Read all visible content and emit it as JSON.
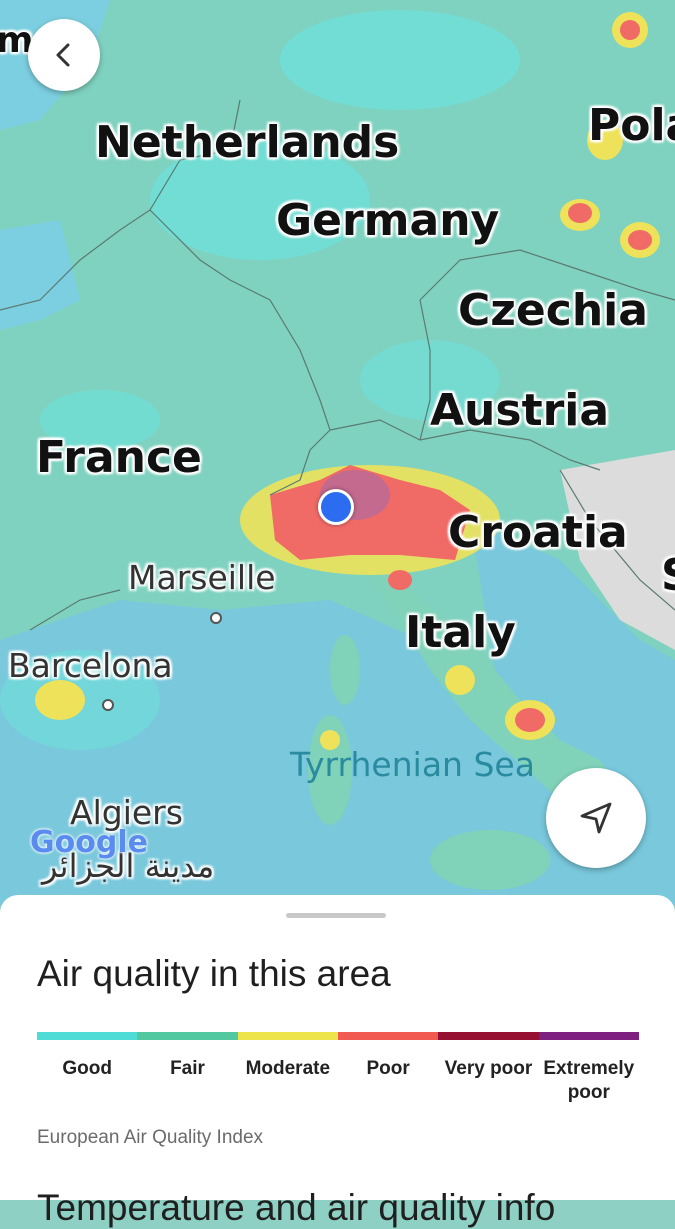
{
  "map": {
    "countries": [
      "Netherlands",
      "Germany",
      "Czechia",
      "Austria",
      "France",
      "Croatia",
      "Italy",
      "Pola"
    ],
    "cities": [
      "Marseille",
      "Barcelona",
      "Algiers"
    ],
    "algiers_arabic": "مدينة الجزائر",
    "sea": "Tyrrhenian Sea",
    "top_left_partial": "m",
    "right_partial": "S",
    "watermark": "Google",
    "back_icon": "chevron-left-icon",
    "recenter_icon": "navigation-arrow-icon"
  },
  "sheet": {
    "title": "Air quality in this area",
    "legend": [
      {
        "label": "Good",
        "color": "#4fdcd6"
      },
      {
        "label": "Fair",
        "color": "#52c8a0"
      },
      {
        "label": "Moderate",
        "color": "#ece44a"
      },
      {
        "label": "Poor",
        "color": "#f05a50"
      },
      {
        "label": "Very poor",
        "color": "#961032"
      },
      {
        "label": "Extremely poor",
        "color": "#7d2080"
      }
    ],
    "source": "European Air Quality Index",
    "next_heading": "Temperature and air quality info"
  }
}
